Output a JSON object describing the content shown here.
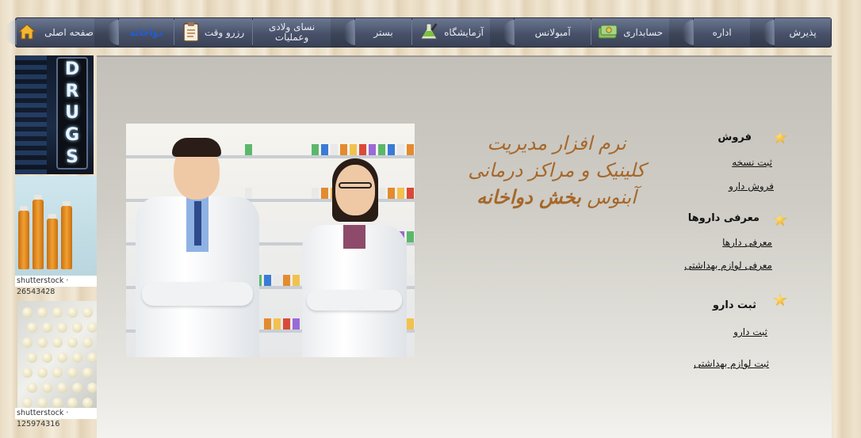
{
  "nav": {
    "items": [
      {
        "label": "پذیرش",
        "icon": ""
      },
      {
        "label": "اداره",
        "icon": ""
      },
      {
        "label": "حسابداری",
        "icon": "money-icon"
      },
      {
        "label": "آمبولانس",
        "icon": ""
      },
      {
        "label": "آزمایشگاه",
        "icon": "flask-icon"
      },
      {
        "label": "بستر",
        "icon": ""
      },
      {
        "label": "نسای ولادی وعملیات",
        "icon": ""
      },
      {
        "label": "رزرو وقت",
        "icon": "clipboard-icon"
      },
      {
        "label": "دواخانه",
        "icon": "",
        "active": true
      },
      {
        "label": "صفحه اصلی",
        "icon": "home-icon"
      }
    ]
  },
  "left_column": {
    "sign_text": "DRUGS",
    "credit_1": "shutterstock · 26543428",
    "credit_2": "shutterstock · 125974316"
  },
  "headline": {
    "line1": "نرم افزار مدیریت",
    "line2": "کلینیک و مراکز درمانی",
    "line3_normal": "آبنوس ",
    "line3_bold": "بخش دواخانه"
  },
  "menu": {
    "sales": {
      "title": "فروش",
      "links": [
        "ثبت نسخه",
        "فروش دارو"
      ]
    },
    "drugs_intro": {
      "title": "معرفی داروها",
      "links": [
        "معرفی دارها",
        "معرفی لوازم بهداشتی"
      ]
    },
    "register": {
      "title": "ثبت دارو",
      "links": [
        "ثبت دارو",
        "ثبت لوازم بهداشتی"
      ]
    }
  },
  "colors": {
    "nav_bg": "#3d4558",
    "nav_active_text": "#1f5ed6",
    "headline_text": "#a6672a"
  }
}
